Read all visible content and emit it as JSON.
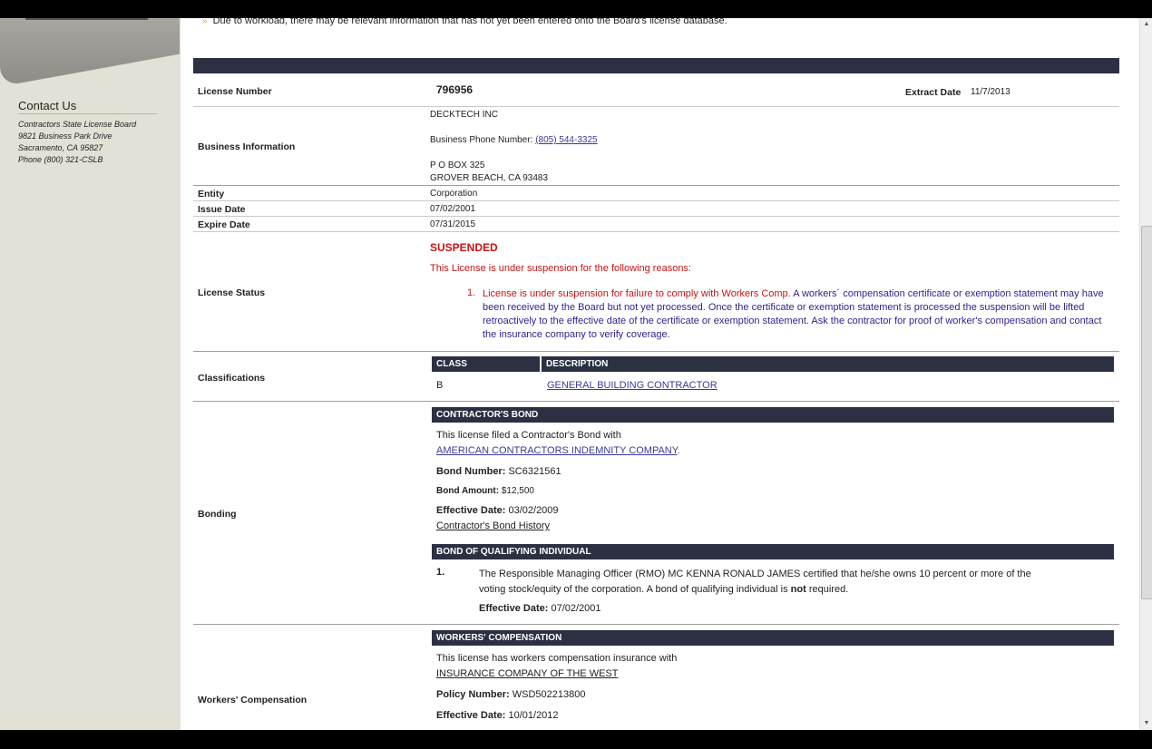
{
  "sidebar": {
    "contact_title": "Contact Us",
    "contact_lines": [
      "Contractors State License Board",
      "9821 Business Park Drive",
      "Sacramento, CA 95827",
      "Phone (800) 321-CSLB"
    ]
  },
  "notice": "Due to workload, there may be relevant information that has not yet been entered onto the Board's license database.",
  "license": {
    "number_label": "License Number",
    "number": "796956",
    "extract_label": "Extract Date",
    "extract_date": "11/7/2013",
    "business_label": "Business Information",
    "business_name": "DECKTECH INC",
    "phone_label": "Business Phone Number:",
    "phone": "(805) 544-3325",
    "address1": "P O BOX 325",
    "address2": "GROVER BEACH, CA 93483",
    "entity_label": "Entity",
    "entity": "Corporation",
    "issue_label": "Issue Date",
    "issue_date": "07/02/2001",
    "expire_label": "Expire Date",
    "expire_date": "07/31/2015",
    "status_label": "License Status",
    "status": "SUSPENDED",
    "status_intro": "This License is under suspension for the following reasons:",
    "reason_num": "1.",
    "reason_red": "License is under suspension for failure to comply with Workers Comp.",
    "reason_blue": "A workers´ compensation certificate or exemption statement may have been received by the Board but not yet processed. Once the certificate or exemption statement is processed the suspension will be lifted retroactively to the effective date of the certificate or exemption statement. Ask the contractor for proof of worker's compensation and contact the insurance company to verify coverage."
  },
  "classifications": {
    "label": "Classifications",
    "col_class": "CLASS",
    "col_desc": "DESCRIPTION",
    "rows": [
      {
        "class": "B",
        "description": "GENERAL BUILDING CONTRACTOR"
      }
    ]
  },
  "bonding": {
    "label": "Bonding",
    "contractor_head": "CONTRACTOR'S BOND",
    "filed_text": "This license filed a Contractor's Bond with",
    "company": "AMERICAN CONTRACTORS INDEMNITY COMPANY",
    "bond_number_label": "Bond Number:",
    "bond_number": "SC6321561",
    "bond_amount_label": "Bond Amount:",
    "bond_amount": "$12,500",
    "effective_label": "Effective Date:",
    "effective_date": "03/02/2009",
    "history_link": "Contractor's Bond History",
    "qualifying_head": "BOND OF QUALIFYING INDIVIDUAL",
    "q_num": "1.",
    "q_text_a": "The Responsible Managing Officer (RMO) MC KENNA RONALD JAMES certified that he/she owns 10 percent or more of the",
    "q_text_b": "voting stock/equity of the corporation. A bond of qualifying individual is",
    "q_not": "not",
    "q_text_c": "required.",
    "q_effective_label": "Effective Date:",
    "q_effective_date": "07/02/2001"
  },
  "workers_comp": {
    "label": "Workers' Compensation",
    "head": "WORKERS' COMPENSATION",
    "text": "This license has workers compensation insurance with",
    "company": "INSURANCE COMPANY OF THE WEST",
    "policy_label": "Policy Number:",
    "policy": "WSD502213800",
    "effective_label": "Effective Date:",
    "effective_date": "10/01/2012"
  },
  "colors": {
    "header_bar": "#2b3143",
    "status_red": "#c61414",
    "reason_blue": "#35218f",
    "sidebar_bg": "#e3e0d6"
  }
}
